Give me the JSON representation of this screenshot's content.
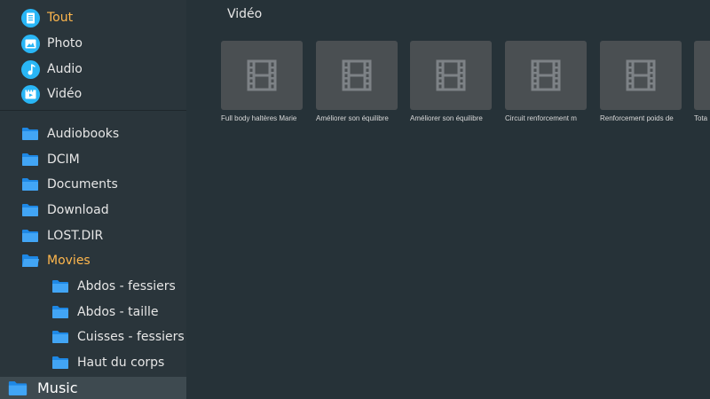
{
  "categories": [
    {
      "label": "Tout",
      "icon": "document-icon",
      "active": true
    },
    {
      "label": "Photo",
      "icon": "photo-icon",
      "active": false
    },
    {
      "label": "Audio",
      "icon": "music-note-icon",
      "active": false
    },
    {
      "label": "Vidéo",
      "icon": "video-icon",
      "active": false
    }
  ],
  "folders": [
    {
      "label": "Audiobooks",
      "level": 0
    },
    {
      "label": "DCIM",
      "level": 0
    },
    {
      "label": "Documents",
      "level": 0
    },
    {
      "label": "Download",
      "level": 0
    },
    {
      "label": "LOST.DIR",
      "level": 0
    },
    {
      "label": "Movies",
      "level": 0,
      "active": true,
      "open": true
    },
    {
      "label": "Abdos - fessiers",
      "level": 1
    },
    {
      "label": "Abdos - taille",
      "level": 1
    },
    {
      "label": "Cuisses - fessiers",
      "level": 1
    },
    {
      "label": "Haut du corps",
      "level": 1
    },
    {
      "label": "Music",
      "level": -1,
      "selected": true
    }
  ],
  "main": {
    "title": "Vidéo",
    "tiles": [
      {
        "label": "Full body haltères Marie"
      },
      {
        "label": "Améliorer son équilibre"
      },
      {
        "label": "Améliorer son équilibre"
      },
      {
        "label": "Circuit renforcement m"
      },
      {
        "label": "Renforcement poids de"
      },
      {
        "label": "Tota"
      }
    ]
  },
  "colors": {
    "accent": "#ffb74d",
    "icon_blue": "#29b6f6",
    "folder_blue": "#2196f3",
    "background": "#263238"
  }
}
